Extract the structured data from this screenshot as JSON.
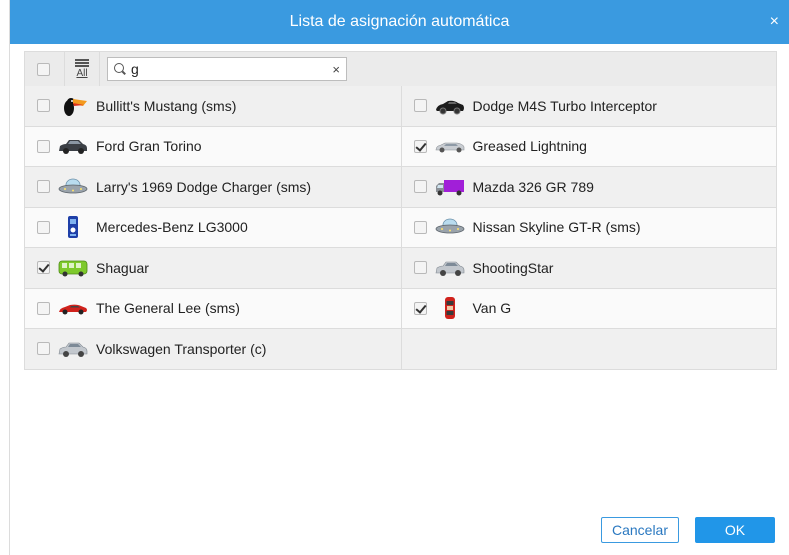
{
  "dialog": {
    "title": "Lista de asignación automática",
    "close_glyph": "×"
  },
  "toolbar": {
    "all_label": "All",
    "search_value": "g",
    "clear_glyph": "×"
  },
  "colors": {
    "title_bar": "#3a9ae0",
    "ok_button": "#2196e8",
    "row_shaded": "#f0f0f0",
    "row_light": "#fafafa"
  },
  "vehicles": [
    {
      "name": "Bullitt's Mustang (sms)",
      "checked": false,
      "icon": "toucan-icon"
    },
    {
      "name": "Dodge M4S Turbo Interceptor",
      "checked": false,
      "icon": "black-sports-car-icon"
    },
    {
      "name": "Ford Gran Torino",
      "checked": false,
      "icon": "dark-sedan-icon"
    },
    {
      "name": "Greased Lightning",
      "checked": true,
      "icon": "silver-limousine-icon"
    },
    {
      "name": "Larry's 1969 Dodge Charger (sms)",
      "checked": false,
      "icon": "ufo-icon"
    },
    {
      "name": "Mazda 326 GR 789",
      "checked": false,
      "icon": "purple-truck-icon"
    },
    {
      "name": "Mercedes-Benz LG3000",
      "checked": false,
      "icon": "blue-bottle-icon"
    },
    {
      "name": "Nissan Skyline GT-R (sms)",
      "checked": false,
      "icon": "ufo-icon"
    },
    {
      "name": "Shaguar",
      "checked": true,
      "icon": "green-bus-icon"
    },
    {
      "name": "ShootingStar",
      "checked": false,
      "icon": "silver-sedan-icon"
    },
    {
      "name": "The General Lee (sms)",
      "checked": false,
      "icon": "red-sports-car-icon"
    },
    {
      "name": "Van G",
      "checked": true,
      "icon": "red-car-topview-icon"
    },
    {
      "name": "Volkswagen Transporter (c)",
      "checked": false,
      "icon": "silver-sedan-icon"
    }
  ],
  "footer": {
    "cancel_label": "Cancelar",
    "ok_label": "OK"
  }
}
